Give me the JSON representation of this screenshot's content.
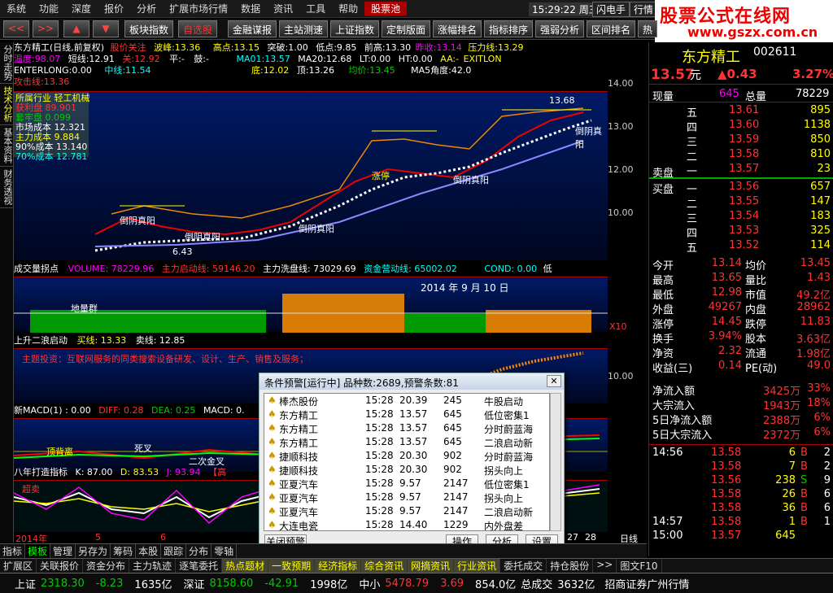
{
  "menu": {
    "items": [
      "系统",
      "功能",
      "深度",
      "报价",
      "分析",
      "扩展市场行情",
      "数据",
      "资讯",
      "工具",
      "帮助",
      "股票池"
    ],
    "clock": "15:29:22 周三",
    "btn1": "闪电手",
    "btn2": "行情"
  },
  "logo": {
    "line1": "股票公式在线网",
    "line2": "www.gszx.com.cn"
  },
  "toolbar": {
    "buttons": [
      "板块指数",
      "自选股",
      "金融谋报",
      "主站测速",
      "上证指数",
      "定制版面",
      "涨幅排名",
      "指标排序",
      "强弱分析",
      "区间排名",
      "热"
    ],
    "arrows": [
      "<<",
      ">>",
      "▲",
      "▼"
    ]
  },
  "lefttabs": [
    "分时走势",
    "技术分析",
    "基本资料",
    "财务透视"
  ],
  "main": {
    "title": "东方精工(日线,前复权)",
    "l1": [
      "股价关注",
      "波峰:13.36",
      "高点:13.15",
      "突破:1.00",
      "低点:9.85",
      "前高:13.30",
      "昨收:13.14",
      "压力线:13.29"
    ],
    "l2": [
      "温度:98.07",
      "短线:12.91",
      "关:12.92",
      "平:-",
      "鼓:-",
      "MA01:13.57",
      "MA20:12.68",
      "LT:0.00",
      "HT:0.00",
      "AA:-",
      "EXITLON"
    ],
    "l3": [
      "ENTERLONG:0.00",
      "中线:11.54",
      "底:12.02",
      "顶:13.26",
      "均价:13.45",
      "MA5角度:42.0"
    ],
    "l4": "攻击线:13.36",
    "info": [
      "所属行业 轻工机械",
      "获利盘 89.901",
      "套牢盘 0.099",
      "市场成本 12.321",
      "主力成本 9.884",
      "90%成本 13.140",
      "70%成本 12.781"
    ],
    "labels": [
      "倒阴真阳",
      "倒阴真阳",
      "倒阴真阳",
      "倒阴真阳",
      "倒阴真阳",
      "涨停",
      "张旺",
      "6.43",
      "13.68"
    ],
    "yaxis": [
      "14.00",
      "13.00",
      "12.00",
      "11.00",
      "10.00",
      "9.00",
      "8.00",
      "7.00"
    ]
  },
  "volume": {
    "hdr": [
      "成交量拐点",
      "VOLUME: 78229.96",
      "主力启动线: 59146.20",
      "主力洗盘线: 73029.69",
      "资金营动线: 65002.02",
      "COND: 0.00",
      "低"
    ],
    "date": "2014 年 9 月 10 日",
    "labels": [
      "地量群",
      "获",
      "利",
      "X10"
    ]
  },
  "p3": {
    "hdr": [
      "上升二浪启动",
      "买线: 13.33",
      "卖线: 12.85"
    ],
    "note": "主题投资：互联网服务的同类搜索设备研发、设计、生产、销售及服务；",
    "yaxis": "10.00"
  },
  "p4": {
    "hdr": [
      "新MACD(1)",
      ": 0.00",
      "DIFF: 0.28",
      "DEA: 0.25",
      "MACD: 0."
    ],
    "labels": [
      "顶背离",
      "死叉",
      "二次金叉",
      "开始走",
      "高"
    ]
  },
  "p5": {
    "hdr": [
      "八年打造指标",
      "K: 87.00",
      "D: 83.53",
      "J: 93.94",
      "【高"
    ],
    "labels": [
      "超卖",
      "顶"
    ],
    "xaxis": [
      "2014年",
      "5",
      "6",
      "7",
      "26",
      "27",
      "28",
      "日线"
    ]
  },
  "dialog": {
    "title": "条件预警[运行中] 品种数:2689,预警条数:81",
    "rows": [
      [
        "棒杰股份",
        "15:28",
        "20.39",
        "245",
        "牛股启动"
      ],
      [
        "东方精工",
        "15:28",
        "13.57",
        "645",
        "低位密集1"
      ],
      [
        "东方精工",
        "15:28",
        "13.57",
        "645",
        "分时蔚蓝海"
      ],
      [
        "东方精工",
        "15:28",
        "13.57",
        "645",
        "二浪启动新"
      ],
      [
        "捷顺科技",
        "15:28",
        "20.30",
        "902",
        "分时蔚蓝海"
      ],
      [
        "捷顺科技",
        "15:28",
        "20.30",
        "902",
        "拐头向上"
      ],
      [
        "亚夏汽车",
        "15:28",
        "9.57",
        "2147",
        "低位密集1"
      ],
      [
        "亚夏汽车",
        "15:28",
        "9.57",
        "2147",
        "拐头向上"
      ],
      [
        "亚夏汽车",
        "15:28",
        "9.57",
        "2147",
        "二浪启动新"
      ],
      [
        "大连电瓷",
        "15:28",
        "14.40",
        "1229",
        "内外盘差"
      ]
    ],
    "close": "关闭预警",
    "op": "操作",
    "ana": "分析",
    "set": "设置"
  },
  "quote": {
    "name": "东方精工",
    "code": "002611",
    "price": "13.57",
    "unit": "元",
    "chg": "▲0.43",
    "pct": "3.27%",
    "now_label": "现量",
    "now": "645",
    "total_label": "总量",
    "total": "78229",
    "asks": [
      [
        "五",
        "13.61",
        "895"
      ],
      [
        "四",
        "13.60",
        "1138"
      ],
      [
        "三",
        "13.59",
        "850"
      ],
      [
        "二",
        "13.58",
        "810"
      ],
      [
        "一",
        "13.57",
        "23"
      ]
    ],
    "ask_label": "卖盘",
    "bids": [
      [
        "一",
        "13.56",
        "657"
      ],
      [
        "二",
        "13.55",
        "147"
      ],
      [
        "三",
        "13.54",
        "183"
      ],
      [
        "四",
        "13.53",
        "325"
      ],
      [
        "五",
        "13.52",
        "114"
      ]
    ],
    "bid_label": "买盘",
    "stats": [
      [
        "今开",
        "13.14",
        "均价",
        "13.45"
      ],
      [
        "最高",
        "13.65",
        "量比",
        "1.43"
      ],
      [
        "最低",
        "12.98",
        "市值",
        "49.2亿"
      ],
      [
        "外盘",
        "49267",
        "内盘",
        "28962"
      ],
      [
        "涨停",
        "14.45",
        "跌停",
        "11.83"
      ],
      [
        "换手",
        "3.94%",
        "股本",
        "3.63亿"
      ],
      [
        "净资",
        "2.32",
        "流通",
        "1.98亿"
      ],
      [
        "收益(三)",
        "0.14",
        "PE(动)",
        "49.0"
      ]
    ],
    "flows": [
      [
        "净流入额",
        "3425万",
        "33%"
      ],
      [
        "大宗流入",
        "1943万",
        "18%"
      ],
      [
        "5日净流入额",
        "2388万",
        "6%"
      ],
      [
        "5日大宗流入",
        "2372万",
        "6%"
      ]
    ],
    "ticks": [
      [
        "14:56",
        "13.58",
        "6",
        "B",
        "2"
      ],
      [
        "",
        "13.58",
        "7",
        "B",
        "2"
      ],
      [
        "",
        "13.56",
        "238",
        "S",
        "9"
      ],
      [
        "",
        "13.58",
        "26",
        "B",
        "6"
      ],
      [
        "",
        "13.58",
        "36",
        "B",
        "6"
      ],
      [
        "14:57",
        "13.58",
        "1",
        "B",
        "1"
      ],
      [
        "15:00",
        "13.57",
        "645",
        "",
        " "
      ]
    ]
  },
  "rtabs": [
    "笔",
    "价",
    "细",
    "盘",
    "势",
    "指",
    "值",
    "筹"
  ],
  "bottomtabs": [
    "指标",
    "模板",
    "管理",
    "另存为",
    "筹码",
    "本股",
    "跟踪",
    "分布",
    "零轴"
  ],
  "catbar": [
    "扩展区",
    "关联报价",
    "资金分布",
    "主力轨迹",
    "逐笔委托",
    "热点题材",
    "一致预期",
    "经济指标",
    "综合资讯",
    "网摘资讯",
    "行业资讯",
    "委托成交",
    "持仓股份",
    ">>",
    "图文F10"
  ],
  "status": {
    "sh_label": "上证",
    "sh": "2318.30",
    "sh_chg": "-8.23",
    "sh_amt": "1635亿",
    "sz_label": "深证",
    "sz": "8158.60",
    "sz_chg": "-42.91",
    "sz_amt": "1998亿",
    "zx_label": "中小",
    "zx": "5478.79",
    "zx_chg": "3.69",
    "zx_amt": "854.0亿",
    "tot_label": "总成交",
    "tot": "3632亿",
    "broker": "招商证券广州行情"
  }
}
